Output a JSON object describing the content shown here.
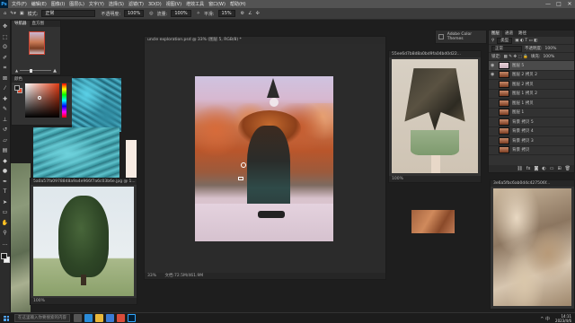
{
  "menubar": {
    "logo": "Ps",
    "items": [
      "文件(F)",
      "编辑(E)",
      "图像(I)",
      "图层(L)",
      "文字(Y)",
      "选择(S)",
      "滤镜(T)",
      "3D(D)",
      "视图(V)",
      "增效工具",
      "窗口(W)",
      "帮助(H)"
    ],
    "win_controls": [
      "—",
      "□",
      "✕"
    ]
  },
  "optionsbar": {
    "mode_label": "模式:",
    "mode_value": "正常",
    "opacity_label": "不透明度:",
    "opacity_value": "100%",
    "flow_label": "流量:",
    "flow_value": "100%",
    "smoothing_label": "平滑:",
    "smoothing_value": "15%"
  },
  "navigator": {
    "tabs": [
      "导航器",
      "直方图"
    ]
  },
  "color_panel": {
    "title": "颜色"
  },
  "main_document": {
    "title": "uncle exploration.psd @ 33% (图层 5, RGB/8) *",
    "status_zoom": "33%",
    "status_info": "文档:72.5M/461.9M"
  },
  "tree_window": {
    "title": "5a0a57fa0978848a9a4e966f7a6c03b6e.jpg @ 1...",
    "zoom": "100%"
  },
  "dress_window": {
    "title": "55ee6d7b8d8a0bd9fa04bd0d22...",
    "zoom": "100%"
  },
  "bark_window": {
    "title": "3e6a5fbc6ab0d4c427506f..."
  },
  "color_themes": {
    "label": "Adobe Color Themes"
  },
  "layers": {
    "tabs": [
      "图层",
      "通道",
      "路径"
    ],
    "kind_filter": "类型",
    "blend_mode": "正常",
    "opacity_label": "不透明度:",
    "opacity_value": "100%",
    "lock_label": "锁定:",
    "fill_label": "填充:",
    "fill_value": "100%",
    "items": [
      {
        "name": "图层 5",
        "visible": true,
        "active": true
      },
      {
        "name": "图层 2 拷贝 2",
        "visible": true,
        "active": false
      },
      {
        "name": "图层 2 拷贝",
        "visible": false,
        "active": false
      },
      {
        "name": "图层 1 拷贝 2",
        "visible": false,
        "active": false
      },
      {
        "name": "图层 1 拷贝",
        "visible": false,
        "active": false
      },
      {
        "name": "图层 1",
        "visible": false,
        "active": false
      },
      {
        "name": "背景 拷贝 5",
        "visible": false,
        "active": false
      },
      {
        "name": "背景 拷贝 4",
        "visible": false,
        "active": false
      },
      {
        "name": "背景 拷贝 3",
        "visible": false,
        "active": false
      },
      {
        "name": "背景 拷贝",
        "visible": false,
        "active": false
      }
    ],
    "footer_icons": [
      "link-icon",
      "fx-icon",
      "mask-icon",
      "adjustment-icon",
      "folder-icon",
      "new-layer-icon",
      "trash-icon"
    ]
  },
  "taskbar": {
    "search_placeholder": "在这里输入你要搜索的内容",
    "tray": "^ 中",
    "time": "14:11",
    "date": "2023/4/6"
  },
  "colors": {
    "ps_bg": "#1e1e1e",
    "panel": "#323232",
    "accent_blue": "#31a8ff",
    "fg_color": "#1b1b1b",
    "bg_color": "#f0f0f0"
  }
}
